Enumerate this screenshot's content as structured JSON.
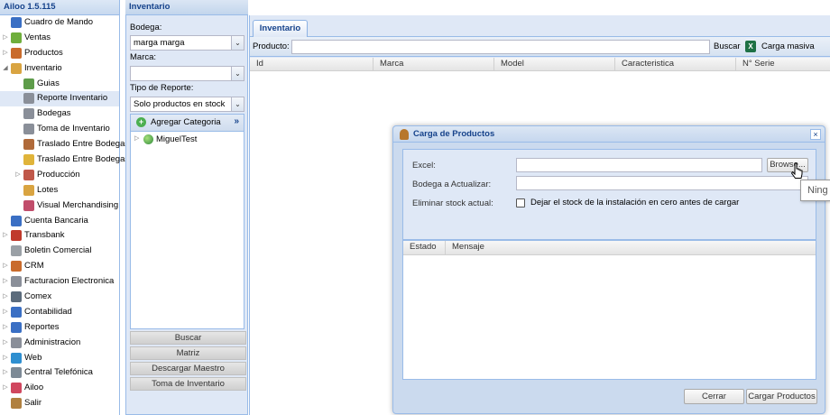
{
  "app": {
    "title": "Ailoo 1.5.115"
  },
  "nav": {
    "items": [
      {
        "label": "Cuadro de Mando",
        "level": 0,
        "arrow": "",
        "icon": "chart-icon",
        "color": "#3a6fc4"
      },
      {
        "label": "Ventas",
        "level": 0,
        "arrow": "▷",
        "icon": "money-icon",
        "color": "#6fae3c"
      },
      {
        "label": "Productos",
        "level": 0,
        "arrow": "▷",
        "icon": "box-icon",
        "color": "#c96b2c"
      },
      {
        "label": "Inventario",
        "level": 0,
        "arrow": "◢",
        "icon": "boxes-icon",
        "color": "#d9a441"
      },
      {
        "label": "Guias",
        "level": 1,
        "arrow": "",
        "icon": "guide-icon",
        "color": "#5e9c4a"
      },
      {
        "label": "Reporte Inventario",
        "level": 1,
        "arrow": "",
        "icon": "report-icon",
        "color": "#8a8f99",
        "selected": true
      },
      {
        "label": "Bodegas",
        "level": 1,
        "arrow": "",
        "icon": "warehouse-icon",
        "color": "#8a8f99"
      },
      {
        "label": "Toma de Inventario",
        "level": 1,
        "arrow": "",
        "icon": "clipboard-icon",
        "color": "#8a8f99"
      },
      {
        "label": "Traslado Entre Bodegas",
        "level": 1,
        "arrow": "",
        "icon": "truck-icon",
        "color": "#b06a3a"
      },
      {
        "label": "Traslado Entre Bodegas",
        "level": 1,
        "arrow": "",
        "icon": "folder-icon",
        "color": "#e0b43a"
      },
      {
        "label": "Producción",
        "level": 1,
        "arrow": "▷",
        "icon": "factory-icon",
        "color": "#c0584a"
      },
      {
        "label": "Lotes",
        "level": 1,
        "arrow": "",
        "icon": "lots-icon",
        "color": "#d9a441"
      },
      {
        "label": "Visual Merchandising",
        "level": 1,
        "arrow": "",
        "icon": "merch-icon",
        "color": "#c14d6b"
      },
      {
        "label": "Cuenta Bancaria",
        "level": 0,
        "arrow": "",
        "icon": "bank-icon",
        "color": "#3a6fc4"
      },
      {
        "label": "Transbank",
        "level": 0,
        "arrow": "▷",
        "icon": "transbank-icon",
        "color": "#c0392b"
      },
      {
        "label": "Boletin Comercial",
        "level": 0,
        "arrow": "",
        "icon": "tag-icon",
        "color": "#9aa0a6"
      },
      {
        "label": "CRM",
        "level": 0,
        "arrow": "▷",
        "icon": "crm-icon",
        "color": "#c96b2c"
      },
      {
        "label": "Facturacion Electronica",
        "level": 0,
        "arrow": "▷",
        "icon": "invoice-icon",
        "color": "#8a8f99"
      },
      {
        "label": "Comex",
        "level": 0,
        "arrow": "▷",
        "icon": "comex-icon",
        "color": "#5b6b7c"
      },
      {
        "label": "Contabilidad",
        "level": 0,
        "arrow": "▷",
        "icon": "ledger-icon",
        "color": "#3a6fc4"
      },
      {
        "label": "Reportes",
        "level": 0,
        "arrow": "▷",
        "icon": "reports-icon",
        "color": "#3a6fc4"
      },
      {
        "label": "Administracion",
        "level": 0,
        "arrow": "▷",
        "icon": "gear-icon",
        "color": "#8a8f99"
      },
      {
        "label": "Web",
        "level": 0,
        "arrow": "▷",
        "icon": "globe-icon",
        "color": "#2f8fd0"
      },
      {
        "label": "Central Telefónica",
        "level": 0,
        "arrow": "▷",
        "icon": "phone-icon",
        "color": "#7d8a96"
      },
      {
        "label": "Ailoo",
        "level": 0,
        "arrow": "▷",
        "icon": "flower-icon",
        "color": "#d0475f"
      },
      {
        "label": "Salir",
        "level": 0,
        "arrow": "",
        "icon": "exit-icon",
        "color": "#b08040"
      }
    ]
  },
  "filter": {
    "title": "Inventario",
    "bodega_label": "Bodega:",
    "bodega_value": "marga marga",
    "marca_label": "Marca:",
    "marca_value": "",
    "tipo_label": "Tipo de Reporte:",
    "tipo_value": "Solo productos en stock",
    "add_category": "Agregar Categoria",
    "more": "»",
    "tree_node": "MiguelTest",
    "buttons": [
      "Buscar",
      "Matriz",
      "Descargar Maestro",
      "Toma de Inventario"
    ]
  },
  "main": {
    "tab": "Inventario",
    "producto_label": "Producto:",
    "buscar": "Buscar",
    "carga_masiva": "Carga masiva",
    "columns": [
      "Id",
      "Marca",
      "Model",
      "Caracteristica",
      "N° Serie"
    ]
  },
  "modal": {
    "title": "Carga de Productos",
    "close": "×",
    "excel_label": "Excel:",
    "browse": "Browse...",
    "bodega_label": "Bodega a Actualizar:",
    "eliminar_label": "Eliminar stock actual:",
    "checkbox_label": "Dejar el stock de la instalación en cero antes de cargar",
    "columns": [
      "Estado",
      "Mensaje"
    ],
    "cerrar": "Cerrar",
    "cargar": "Cargar Productos"
  },
  "tooltip": "Ning"
}
